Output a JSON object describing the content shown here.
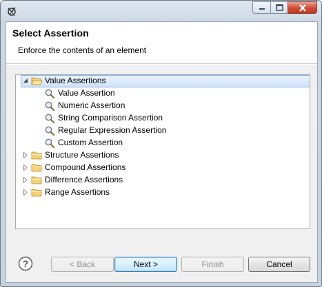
{
  "window": {
    "controls": {
      "minimize_icon": "minimize-icon",
      "maximize_icon": "maximize-icon",
      "close_icon": "close-icon"
    }
  },
  "header": {
    "title": "Select Assertion",
    "description": "Enforce the contents of an element"
  },
  "tree": {
    "items": [
      {
        "label": "Value Assertions",
        "type": "folder",
        "expanded": true,
        "selected": true
      },
      {
        "label": "Value Assertion",
        "type": "leaf"
      },
      {
        "label": "Numeric Assertion",
        "type": "leaf"
      },
      {
        "label": "String Comparison Assertion",
        "type": "leaf"
      },
      {
        "label": "Regular Expression Assertion",
        "type": "leaf"
      },
      {
        "label": "Custom Assertion",
        "type": "leaf"
      },
      {
        "label": "Structure Assertions",
        "type": "folder",
        "expanded": false
      },
      {
        "label": "Compound Assertions",
        "type": "folder",
        "expanded": false
      },
      {
        "label": "Difference Assertions",
        "type": "folder",
        "expanded": false
      },
      {
        "label": "Range Assertions",
        "type": "folder",
        "expanded": false
      }
    ]
  },
  "buttons": {
    "back": "< Back",
    "next": "Next >",
    "finish": "Finish",
    "cancel": "Cancel"
  },
  "colors": {
    "selection_border": "#84acdd",
    "folder": "#e8b84a",
    "default_button_border": "#3c7fb1"
  }
}
